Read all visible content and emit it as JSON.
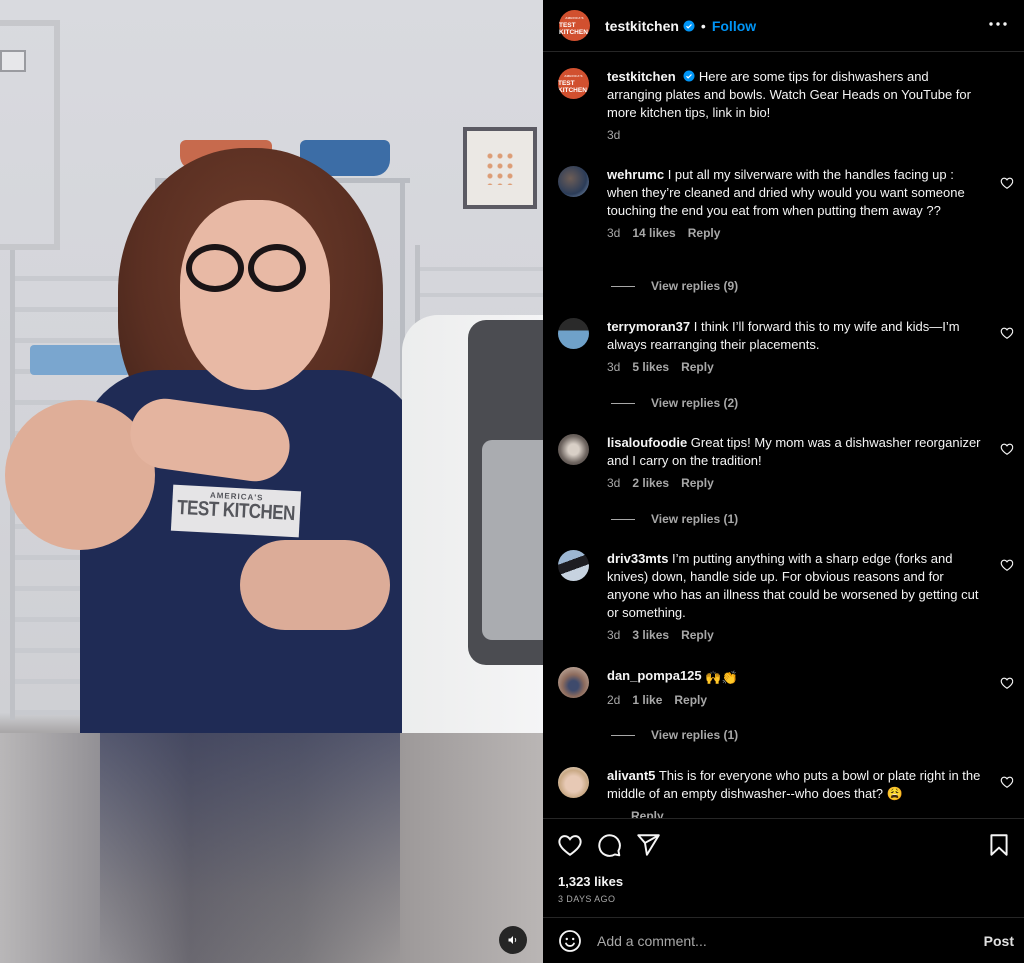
{
  "media": {
    "badge_line1": "AMERICA'S",
    "badge_line2": "TEST KITCHEN",
    "mute_icon": "speaker-icon"
  },
  "header": {
    "avatar_text_top": "AMERICA'S",
    "avatar_text_bottom": "TEST KITCHEN",
    "username": "testkitchen",
    "verified": true,
    "separator": "•",
    "follow_label": "Follow",
    "more_icon": "more-horizontal-icon"
  },
  "caption": {
    "username": "testkitchen",
    "text": "Here are some tips for dishwashers and arranging plates and bowls. Watch Gear Heads on YouTube for more kitchen tips, link in bio!",
    "time": "3d"
  },
  "comments": [
    {
      "username": "wehrumc",
      "text": "I put all my silverware with the handles facing up : when they’re cleaned and dried why would you want someone touching the end you eat from when putting them away ??",
      "time": "3d",
      "likes": "14 likes",
      "reply_label": "Reply",
      "view_replies": "View replies (9)"
    },
    {
      "username": "terrymoran37",
      "text": "I think I’ll forward this to my wife and kids—I’m always rearranging their placements.",
      "time": "3d",
      "likes": "5 likes",
      "reply_label": "Reply",
      "view_replies": "View replies (2)"
    },
    {
      "username": "lisaloufoodie",
      "text": "Great tips! My mom was a dishwasher reorganizer and I carry on the tradition!",
      "time": "3d",
      "likes": "2 likes",
      "reply_label": "Reply",
      "view_replies": "View replies (1)"
    },
    {
      "username": "driv33mts",
      "text": "I’m putting anything with a sharp edge (forks and knives) down, handle side up. For obvious reasons and for anyone who has an illness that could be worsened by getting cut or something.",
      "time": "3d",
      "likes": "3 likes",
      "reply_label": "Reply"
    },
    {
      "username": "dan_pompa125",
      "text": "🙌👏",
      "time": "2d",
      "likes": "1 like",
      "reply_label": "Reply",
      "view_replies": "View replies (1)"
    },
    {
      "username": "alivant5",
      "text": "This is for everyone who puts a bowl or plate right in the middle of an empty dishwasher--who does that? 😩",
      "time": "",
      "likes": "",
      "reply_label": "Reply"
    }
  ],
  "actions": {
    "like_icon": "heart-icon",
    "comment_icon": "comment-icon",
    "share_icon": "send-icon",
    "save_icon": "bookmark-icon",
    "likes_count": "1,323 likes",
    "posted_ago": "3 DAYS AGO"
  },
  "composer": {
    "placeholder": "Add a comment...",
    "post_label": "Post"
  },
  "colors": {
    "background": "#000000",
    "follow_blue": "#0095f6",
    "brand_orange": "#d1502f",
    "muted_text": "#a8a8a8",
    "divider": "#262626"
  }
}
